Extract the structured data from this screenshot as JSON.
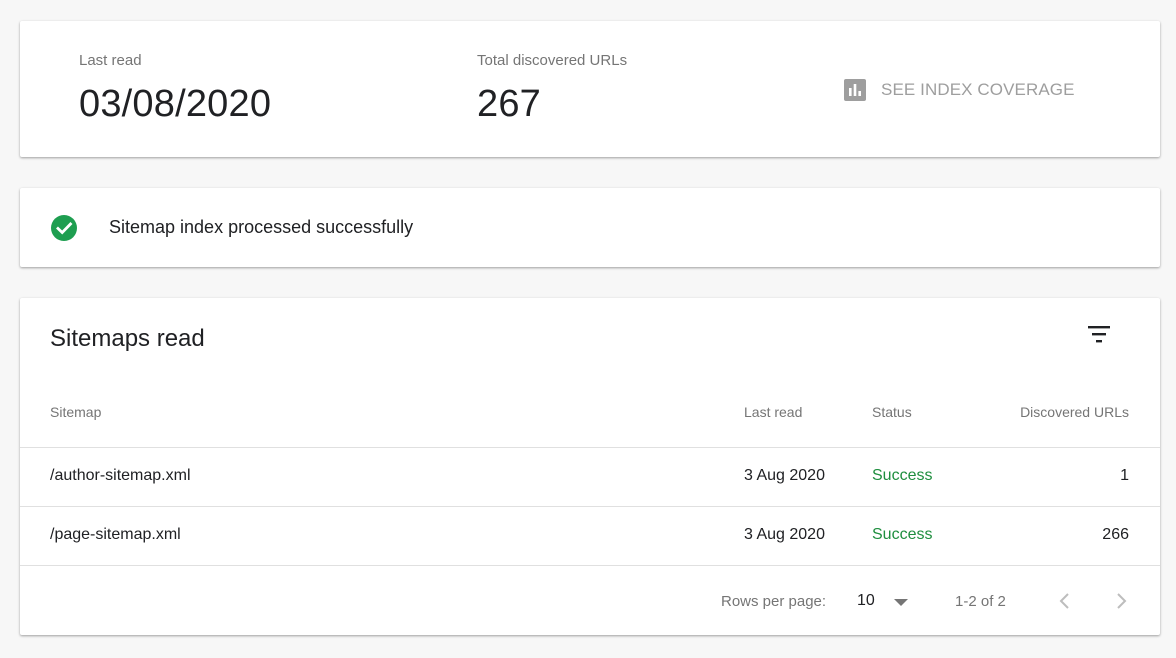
{
  "summary": {
    "last_read_label": "Last read",
    "last_read_value": "03/08/2020",
    "total_urls_label": "Total discovered URLs",
    "total_urls_value": "267",
    "coverage_button_label": "SEE INDEX COVERAGE",
    "coverage_icon": "bar-chart-icon"
  },
  "status": {
    "icon": "check-circle-icon",
    "message": "Sitemap index processed successfully"
  },
  "sitemaps": {
    "title": "Sitemaps read",
    "filter_icon": "filter-icon",
    "columns": [
      "Sitemap",
      "Last read",
      "Status",
      "Discovered URLs"
    ],
    "rows": [
      {
        "sitemap": "/author-sitemap.xml",
        "last_read": "3 Aug 2020",
        "status": "Success",
        "discovered_urls": "1"
      },
      {
        "sitemap": "/page-sitemap.xml",
        "last_read": "3 Aug 2020",
        "status": "Success",
        "discovered_urls": "266"
      }
    ],
    "pagination": {
      "rows_per_page_label": "Rows per page:",
      "rows_per_page_value": "10",
      "range": "1-2 of 2",
      "prev_icon": "chevron-left-icon",
      "next_icon": "chevron-right-icon"
    }
  },
  "colors": {
    "success": "#1e8e3e",
    "check_icon": "#1e9e50",
    "muted_text": "#757575",
    "icon_gray": "#9e9e9e"
  }
}
